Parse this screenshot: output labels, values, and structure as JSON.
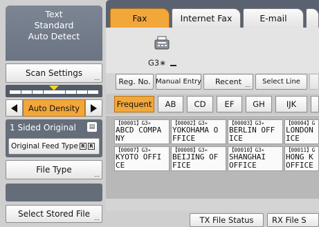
{
  "settings_panel": {
    "line1": "Text",
    "line2": "Standard",
    "line3": "Auto Detect"
  },
  "scan_settings_label": "Scan Settings",
  "density": {
    "label": "Auto Density",
    "level_fraction": 0.5
  },
  "original": {
    "sided_label": "1 Sided Original",
    "feed_type_label": "Original Feed Type"
  },
  "file_type_label": "File Type",
  "select_stored_file_label": "Select Stored File",
  "tabs": [
    {
      "label": "Fax",
      "active": true
    },
    {
      "label": "Internet Fax",
      "active": false
    },
    {
      "label": "E-mail",
      "active": false
    }
  ],
  "destination": {
    "mode_text": "G3∗",
    "cursor": "_"
  },
  "toolbar": {
    "reg_no_label": "Reg. No.",
    "manual_entry_label": "Manual Entry",
    "recent_label": "Recent",
    "select_line_label": "Select Line"
  },
  "index_tabs": [
    "Frequent",
    "AB",
    "CD",
    "EF",
    "GH",
    "IJK"
  ],
  "destinations": [
    {
      "header": "【00001】G3∗",
      "line1": "ABCD COMPA",
      "line2": "NY"
    },
    {
      "header": "【00002】G3∗",
      "line1": "YOKOHAMA O",
      "line2": "FFICE"
    },
    {
      "header": "【00003】G3∗",
      "line1": "BERLIN OFF",
      "line2": "ICE"
    },
    {
      "header": "【00004】G",
      "line1": "LONDON",
      "line2": "ICE"
    },
    {
      "header": "【00007】G3∗",
      "line1": "KYOTO OFFI",
      "line2": "CE"
    },
    {
      "header": "【00008】G3∗",
      "line1": "BEIJING OF",
      "line2": "FICE"
    },
    {
      "header": "【00010】G3∗",
      "line1": "SHANGHAI",
      "line2": "OFFICE"
    },
    {
      "header": "【00011】G",
      "line1": "HONG K",
      "line2": "OFFICE"
    }
  ],
  "bottom": {
    "tx_file_status_label": "TX File Status",
    "rx_file_status_label": "RX File S"
  },
  "colors": {
    "accent_orange": "#f2a73a",
    "panel_gray": "#656d7a",
    "slider_marker": "#f7d51e"
  }
}
